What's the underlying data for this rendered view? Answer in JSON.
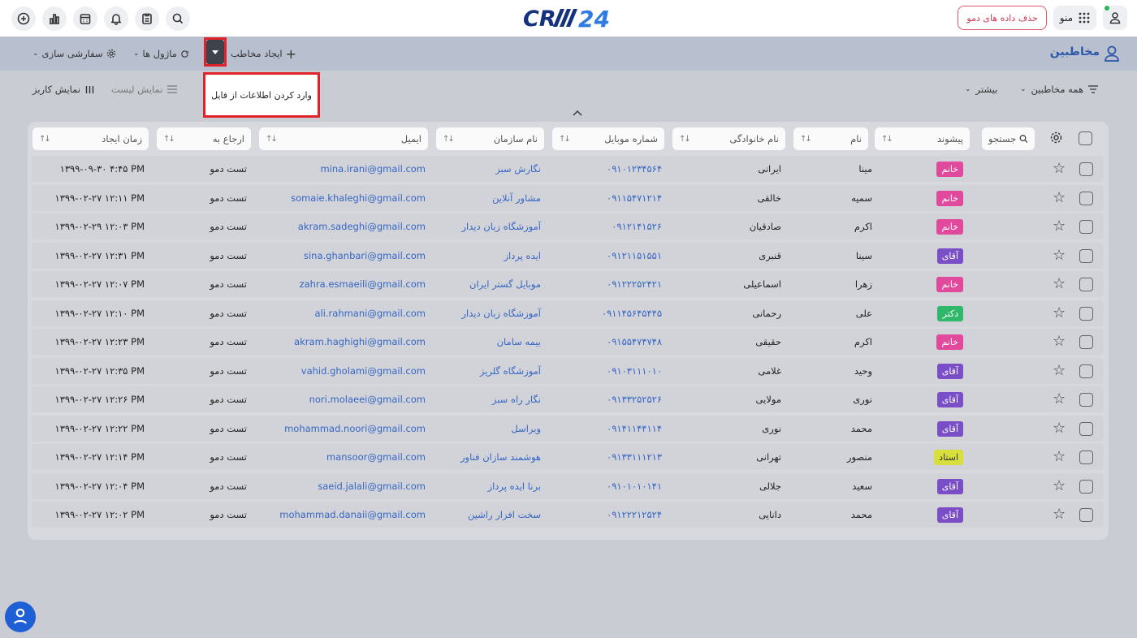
{
  "header": {
    "logo_text": "CRM24",
    "delete_demo": "حذف داده های دمو",
    "menu_label": "منو"
  },
  "toolbar": {
    "customize": "سفارشی سازی",
    "modules": "ماژول ها",
    "create_contact": "ایجاد مخاطب",
    "page_title": "مخاطبین"
  },
  "popup": {
    "import_label": "وارد کردن اطلاعات از فایل"
  },
  "subtoolbar": {
    "user_view": "نمایش کاربز",
    "list_view": "نمایش لیست",
    "all_contacts": "همه مخاطبین",
    "more": "بیشتر"
  },
  "table": {
    "search_label": "جستجو",
    "headers": {
      "prefix": "پیشوند",
      "first_name": "نام",
      "last_name": "نام خانوادگی",
      "mobile": "شماره موبایل",
      "organization": "نام سازمان",
      "email": "ایمیل",
      "referred_to": "ارجاع به",
      "created_at": "زمان ایجاد"
    },
    "rows": [
      {
        "prefix": "خانم",
        "prefix_color": "#e0499c",
        "first": "مینا",
        "last": "ایرانی",
        "mobile": "۰۹۱۰۱۲۳۴۵۶۴",
        "org": "نگارش سبز",
        "email": "mina.irani@gmail.com",
        "ref": "تست دمو",
        "created": "۱۳۹۹-۰۹-۳۰ ۴:۴۵ PM"
      },
      {
        "prefix": "خانم",
        "prefix_color": "#e0499c",
        "first": "سمیه",
        "last": "خالقی",
        "mobile": "۰۹۱۱۵۴۷۱۲۱۴",
        "org": "مشاور آنلاین",
        "email": "somaie.khaleghi@gmail.com",
        "ref": "تست دمو",
        "created": "۱۳۹۹-۰۲-۲۷ ۱۲:۱۱ PM"
      },
      {
        "prefix": "خانم",
        "prefix_color": "#e0499c",
        "first": "اکرم",
        "last": "صادقیان",
        "mobile": "۰۹۱۲۱۴۱۵۲۶",
        "org": "آموزشگاه زبان دیدار",
        "email": "akram.sadeghi@gmail.com",
        "ref": "تست دمو",
        "created": "۱۳۹۹-۰۲-۲۹ ۱۲:۰۳ PM"
      },
      {
        "prefix": "آقای",
        "prefix_color": "#7a4ec6",
        "first": "سینا",
        "last": "قنبری",
        "mobile": "۰۹۱۲۱۱۵۱۵۵۱",
        "org": "ایده پرداز",
        "email": "sina.ghanbari@gmail.com",
        "ref": "تست دمو",
        "created": "۱۳۹۹-۰۲-۲۷ ۱۲:۳۱ PM"
      },
      {
        "prefix": "خانم",
        "prefix_color": "#e0499c",
        "first": "زهرا",
        "last": "اسماعیلی",
        "mobile": "۰۹۱۲۲۲۵۲۴۲۱",
        "org": "موبایل گستر ایران",
        "email": "zahra.esmaeili@gmail.com",
        "ref": "تست دمو",
        "created": "۱۳۹۹-۰۲-۲۷ ۱۲:۰۷ PM"
      },
      {
        "prefix": "دکتر",
        "prefix_color": "#2fb86a",
        "first": "علی",
        "last": "رحمانی",
        "mobile": "۰۹۱۱۴۵۶۴۵۴۴۵",
        "org": "آموزشگاه زبان دیدار",
        "email": "ali.rahmani@gmail.com",
        "ref": "تست دمو",
        "created": "۱۳۹۹-۰۲-۲۷ ۱۲:۱۰ PM"
      },
      {
        "prefix": "خانم",
        "prefix_color": "#e0499c",
        "first": "اکرم",
        "last": "حقیقی",
        "mobile": "۰۹۱۵۵۴۷۴۷۴۸",
        "org": "بیمه سامان",
        "email": "akram.haghighi@gmail.com",
        "ref": "تست دمو",
        "created": "۱۳۹۹-۰۲-۲۷ ۱۲:۲۳ PM"
      },
      {
        "prefix": "آقای",
        "prefix_color": "#7a4ec6",
        "first": "وحید",
        "last": "غلامی",
        "mobile": "۰۹۱۰۳۱۱۱۰۱۰",
        "org": "آموزشگاه گلریز",
        "email": "vahid.gholami@gmail.com",
        "ref": "تست دمو",
        "created": "۱۳۹۹-۰۲-۲۷ ۱۲:۳۵ PM"
      },
      {
        "prefix": "آقای",
        "prefix_color": "#7a4ec6",
        "first": "نوری",
        "last": "مولایی",
        "mobile": "۰۹۱۳۳۲۵۲۵۲۶",
        "org": "نگار راه سبز",
        "email": "nori.molaeei@gmail.com",
        "ref": "تست دمو",
        "created": "۱۳۹۹-۰۲-۲۷ ۱۲:۲۶ PM"
      },
      {
        "prefix": "آقای",
        "prefix_color": "#7a4ec6",
        "first": "محمد",
        "last": "نوری",
        "mobile": "۰۹۱۴۱۱۴۴۱۱۴",
        "org": "ویراسل",
        "email": "mohammad.noori@gmail.com",
        "ref": "تست دمو",
        "created": "۱۳۹۹-۰۲-۲۷ ۱۲:۲۲ PM"
      },
      {
        "prefix": "استاد",
        "prefix_color": "#d9df3a",
        "first": "منصور",
        "last": "تهرانی",
        "mobile": "۰۹۱۳۳۱۱۱۲۱۳",
        "org": "هوشمند سازان فناور",
        "email": "mansoor@gmail.com",
        "ref": "تست دمو",
        "created": "۱۳۹۹-۰۲-۲۷ ۱۲:۱۴ PM"
      },
      {
        "prefix": "آقای",
        "prefix_color": "#7a4ec6",
        "first": "سعید",
        "last": "جلالی",
        "mobile": "۰۹۱۰۱۰۱۰۱۴۱",
        "org": "برنا ایده پرداز",
        "email": "saeid.jalali@gmail.com",
        "ref": "تست دمو",
        "created": "۱۳۹۹-۰۲-۲۷ ۱۲:۰۴ PM"
      },
      {
        "prefix": "آقای",
        "prefix_color": "#7a4ec6",
        "first": "محمد",
        "last": "دانایی",
        "mobile": "۰۹۱۲۲۲۱۲۵۲۴",
        "org": "سخت افزار راشین",
        "email": "mohammad.danaii@gmail.com",
        "ref": "تست دمو",
        "created": "۱۳۹۹-۰۲-۲۷ ۱۲:۰۲ PM"
      }
    ]
  }
}
